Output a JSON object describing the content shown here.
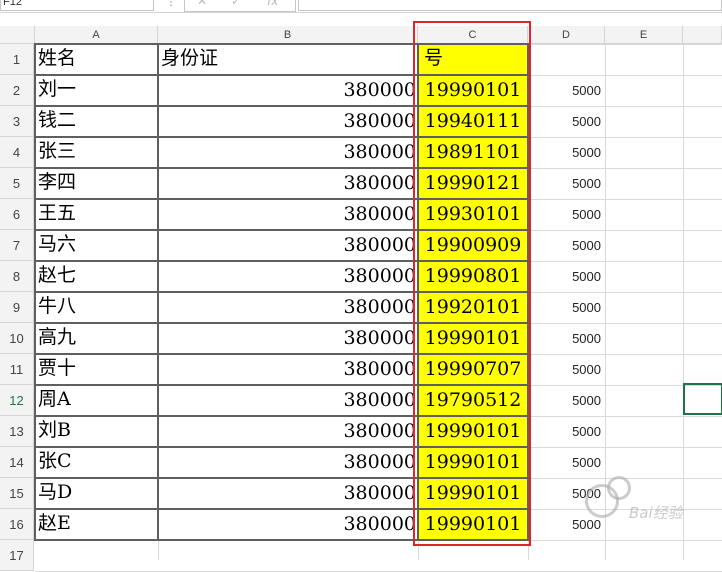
{
  "formula_bar": {
    "name_box": "F12",
    "more_icon": "⋮",
    "cancel_icon": "✕",
    "enter_icon": "✓",
    "fx_label": "fx",
    "formula": ""
  },
  "columns": [
    "A",
    "B",
    "C",
    "D",
    "E"
  ],
  "rows": [
    "1",
    "2",
    "3",
    "4",
    "5",
    "6",
    "7",
    "8",
    "9",
    "10",
    "11",
    "12",
    "13",
    "14",
    "15",
    "16",
    "17"
  ],
  "active_row": "12",
  "table": {
    "headers": {
      "name": "姓名",
      "id": "身份证",
      "number": "号"
    },
    "records": [
      {
        "name": "刘一",
        "id": "380000",
        "number": "19990101",
        "d": "5000"
      },
      {
        "name": "钱二",
        "id": "380000",
        "number": "19940111",
        "d": "5000"
      },
      {
        "name": "张三",
        "id": "380000",
        "number": "19891101",
        "d": "5000"
      },
      {
        "name": "李四",
        "id": "380000",
        "number": "19990121",
        "d": "5000"
      },
      {
        "name": "王五",
        "id": "380000",
        "number": "19930101",
        "d": "5000"
      },
      {
        "name": "马六",
        "id": "380000",
        "number": "19900909",
        "d": "5000"
      },
      {
        "name": "赵七",
        "id": "380000",
        "number": "19990801",
        "d": "5000"
      },
      {
        "name": "牛八",
        "id": "380000",
        "number": "19920101",
        "d": "5000"
      },
      {
        "name": "高九",
        "id": "380000",
        "number": "19990101",
        "d": "5000"
      },
      {
        "name": "贾十",
        "id": "380000",
        "number": "19990707",
        "d": "5000"
      },
      {
        "name": "周A",
        "id": "380000",
        "number": "19790512",
        "d": "5000"
      },
      {
        "name": "刘B",
        "id": "380000",
        "number": "19990101",
        "d": "5000"
      },
      {
        "name": "张C",
        "id": "380000",
        "number": "19990101",
        "d": "5000"
      },
      {
        "name": "马D",
        "id": "380000",
        "number": "19990101",
        "d": "5000"
      },
      {
        "name": "赵E",
        "id": "380000",
        "number": "19990101",
        "d": "5000"
      }
    ]
  },
  "watermark": {
    "text": "Bai经验"
  },
  "colors": {
    "highlight": "#ffff00",
    "annotation_box": "#e0242b",
    "selection": "#217346"
  }
}
